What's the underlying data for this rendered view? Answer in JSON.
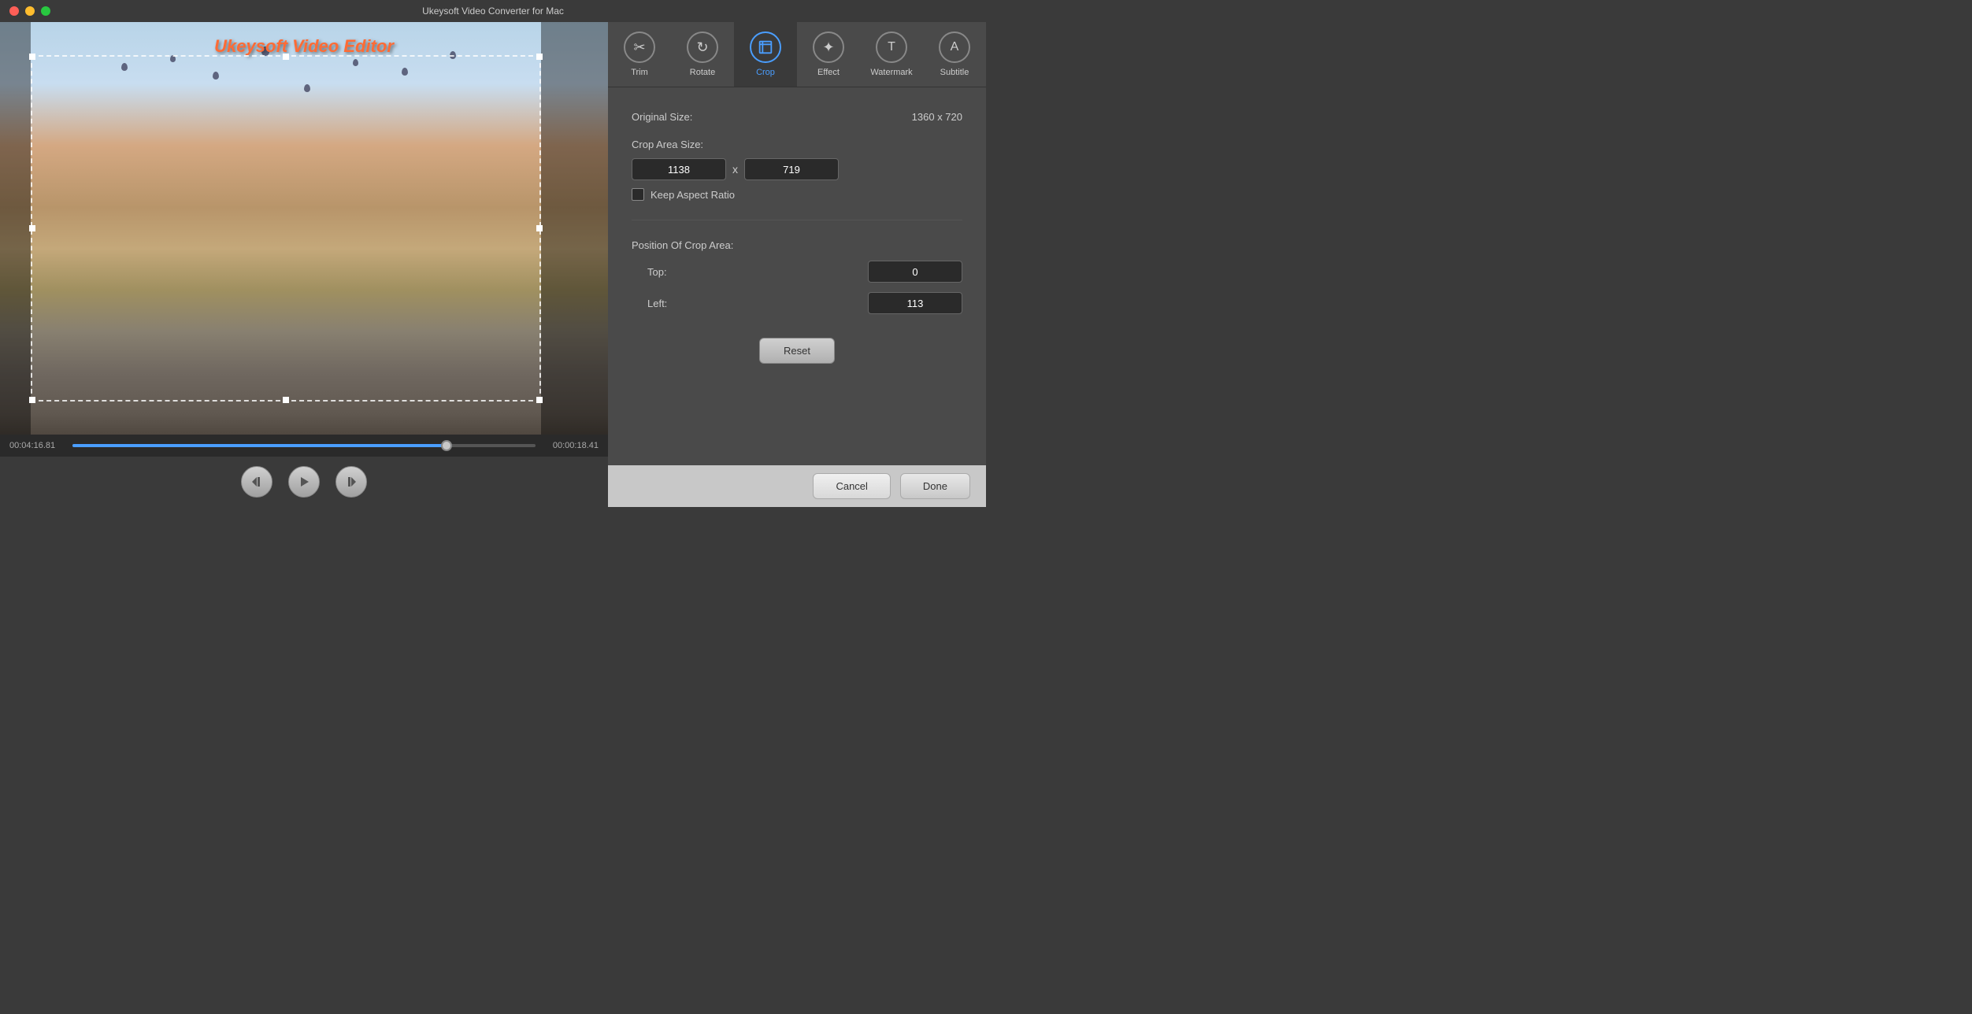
{
  "titleBar": {
    "title": "Ukeysoft Video Converter for Mac"
  },
  "toolbar": {
    "items": [
      {
        "id": "trim",
        "label": "Trim",
        "icon": "✂"
      },
      {
        "id": "rotate",
        "label": "Rotate",
        "icon": "↻"
      },
      {
        "id": "crop",
        "label": "Crop",
        "icon": "⊡",
        "active": true
      },
      {
        "id": "effect",
        "label": "Effect",
        "icon": "✦"
      },
      {
        "id": "watermark",
        "label": "Watermark",
        "icon": "T"
      },
      {
        "id": "subtitle",
        "label": "Subtitle",
        "icon": "A"
      }
    ]
  },
  "video": {
    "overlayText": "Ukeysoft Video Editor",
    "currentTime": "00:04:16.81",
    "remainingTime": "00:00:18.41",
    "progressPercent": 82
  },
  "cropSettings": {
    "originalSizeLabel": "Original Size:",
    "originalSizeValue": "1360 x 720",
    "cropAreaSizeLabel": "Crop Area Size:",
    "cropWidthValue": "1138",
    "cropHeightValue": "719",
    "crossLabel": "x",
    "keepAspectRatioLabel": "Keep Aspect Ratio",
    "positionLabel": "Position Of Crop Area:",
    "topLabel": "Top:",
    "topValue": "0",
    "leftLabel": "Left:",
    "leftValue": "113",
    "resetLabel": "Reset"
  },
  "bottomBar": {
    "cancelLabel": "Cancel",
    "doneLabel": "Done"
  }
}
